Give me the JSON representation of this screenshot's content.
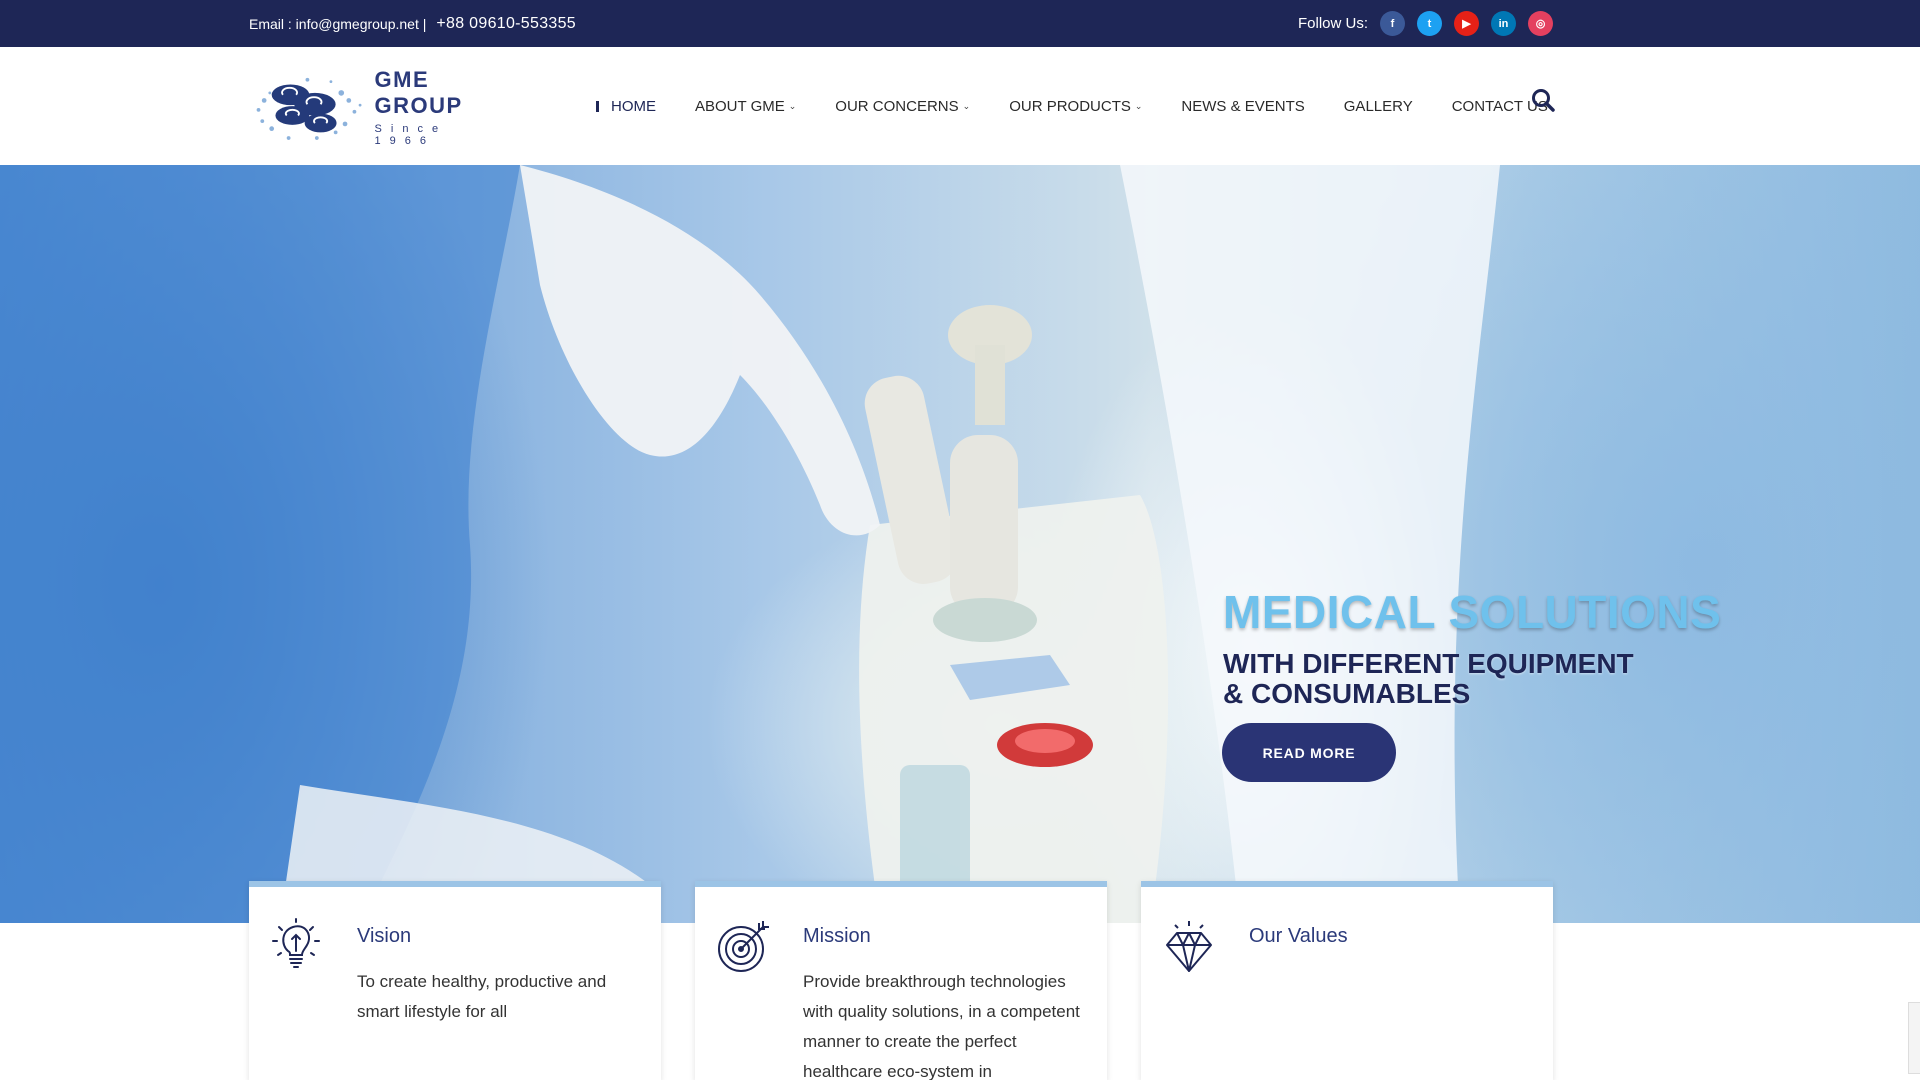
{
  "topbar": {
    "email_text": "Email : info@gmegroup.net |",
    "phone": "+88 09610-553355",
    "follow_label": "Follow Us:",
    "social": [
      {
        "icon": "facebook-icon",
        "glyph": "f"
      },
      {
        "icon": "twitter-icon",
        "glyph": "t"
      },
      {
        "icon": "youtube-icon",
        "glyph": "▶"
      },
      {
        "icon": "linkedin-icon",
        "glyph": "in"
      },
      {
        "icon": "instagram-icon",
        "glyph": "◎"
      }
    ]
  },
  "header": {
    "logo_name": "GME GROUP",
    "logo_since": "Since 1966",
    "nav": [
      {
        "label": "HOME",
        "active": true
      },
      {
        "label": "ABOUT GME",
        "dropdown": true
      },
      {
        "label": "OUR CONCERNS",
        "dropdown": true
      },
      {
        "label": "OUR PRODUCTS",
        "dropdown": true
      },
      {
        "label": "NEWS & EVENTS"
      },
      {
        "label": "GALLERY"
      },
      {
        "label": "CONTACT US"
      }
    ],
    "caret": "⌄"
  },
  "hero": {
    "title": "MEDICAL SOLUTIONS",
    "subtitle_line1": "WITH DIFFERENT EQUIPMENT",
    "subtitle_line2": "& CONSUMABLES",
    "button_label": "READ MORE"
  },
  "cards": [
    {
      "icon": "lightbulb-icon",
      "title": "Vision",
      "text": "To create healthy, productive and smart lifestyle for all"
    },
    {
      "icon": "target-icon",
      "title": "Mission",
      "text": "Provide breakthrough technologies with quality solutions, in a competent manner to create the perfect healthcare eco-system in"
    },
    {
      "icon": "diamond-icon",
      "title": "Our Values",
      "text": ""
    }
  ],
  "colors": {
    "navy": "#1e2656",
    "hero_title": "#6fc1ec",
    "card_accent": "#9cc4e6"
  }
}
